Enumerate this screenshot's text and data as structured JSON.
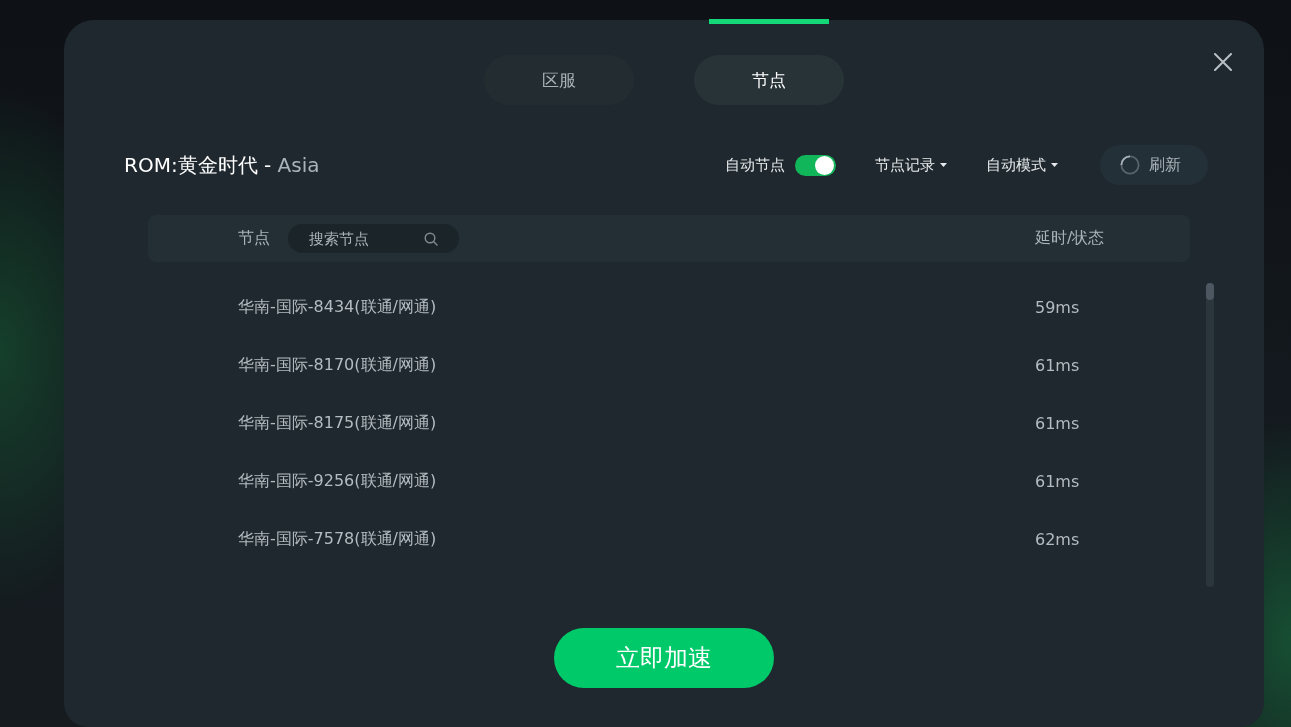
{
  "dialog": {
    "tabs": [
      {
        "label": "区服",
        "selected": false
      },
      {
        "label": "节点",
        "selected": true
      }
    ],
    "title": {
      "game": "ROM:黄金时代 -",
      "region": "Asia"
    },
    "controls": {
      "auto_node": {
        "label": "自动节点",
        "on": true
      },
      "menus": [
        {
          "label": "节点记录"
        },
        {
          "label": "自动模式"
        }
      ],
      "refresh": {
        "label": "刷新"
      }
    },
    "table": {
      "columns": [
        "节点",
        "延时/状态"
      ],
      "search": {
        "placeholder": "搜索节点"
      },
      "rows": [
        {
          "node": "华南-国际-8434(联通/网通)",
          "latency": "59ms"
        },
        {
          "node": "华南-国际-8170(联通/网通)",
          "latency": "61ms"
        },
        {
          "node": "华南-国际-8175(联通/网通)",
          "latency": "61ms"
        },
        {
          "node": "华南-国际-9256(联通/网通)",
          "latency": "61ms"
        },
        {
          "node": "华南-国际-7578(联通/网通)",
          "latency": "62ms"
        }
      ]
    },
    "primary_button": "立即加速"
  }
}
